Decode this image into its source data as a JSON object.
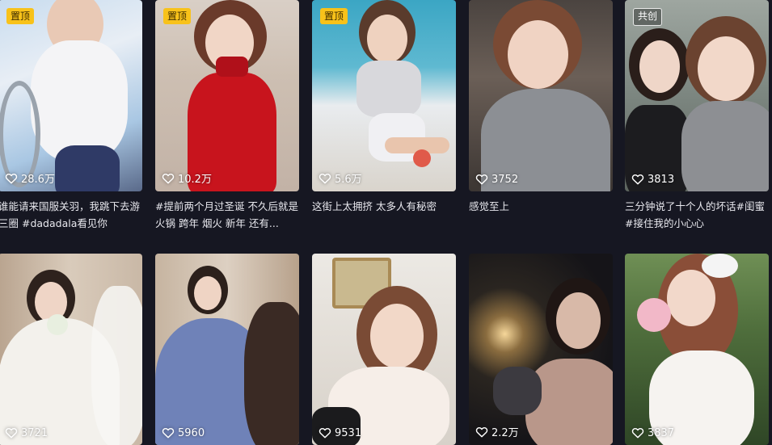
{
  "videos": [
    {
      "badge": "置顶",
      "likes": "28.6万",
      "caption": "谁能请来国服关羽，我跳下去游三圈 #dadadala看见你"
    },
    {
      "badge": "置顶",
      "likes": "10.2万",
      "caption": "#提前两个月过圣诞 不久后就是火锅 跨年 烟火 新年 还有..."
    },
    {
      "badge": "置顶",
      "likes": "5.6万",
      "caption": "这街上太拥挤 太多人有秘密"
    },
    {
      "badge": "",
      "likes": "3752",
      "caption": "感觉至上"
    },
    {
      "badge": "共创",
      "likes": "3813",
      "caption": "三分钟说了十个人的坏话#闺蜜#接住我的小心心"
    },
    {
      "badge": "",
      "likes": "3721",
      "caption": ""
    },
    {
      "badge": "",
      "likes": "5960",
      "caption": ""
    },
    {
      "badge": "",
      "likes": "9531",
      "caption": ""
    },
    {
      "badge": "",
      "likes": "2.2万",
      "caption": ""
    },
    {
      "badge": "",
      "likes": "3837",
      "caption": ""
    }
  ],
  "colors": {
    "background": "#161722",
    "pinned_badge": "#f8c21a",
    "caption_text": "#e8e8ee"
  },
  "icons": {
    "likes": "heart-outline-icon"
  }
}
